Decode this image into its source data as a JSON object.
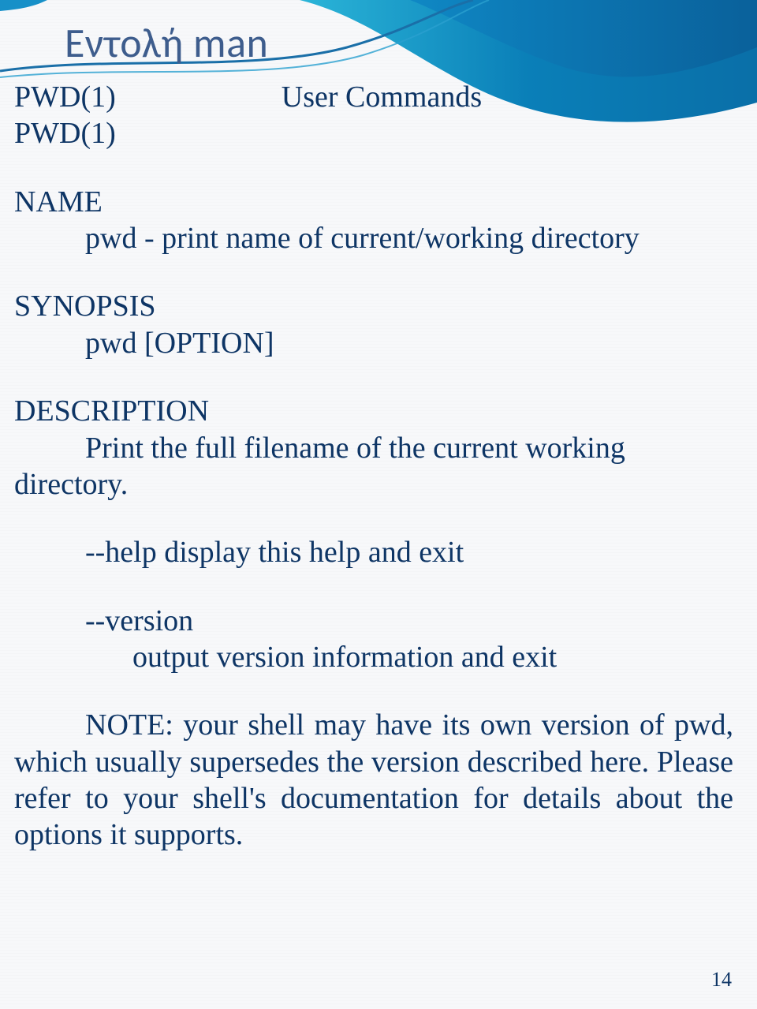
{
  "slide": {
    "title": "Εντολή man",
    "page_number": "14"
  },
  "man": {
    "header_left": "PWD(1)",
    "header_center": "User Commands",
    "header_left_repeat": "PWD(1)",
    "name_heading": "NAME",
    "name_text": "pwd - print name of current/working directory",
    "synopsis_heading": "SYNOPSIS",
    "synopsis_text": "pwd [OPTION]",
    "description_heading": "DESCRIPTION",
    "description_line1": "Print the full filename of the current working",
    "description_line2": "directory.",
    "help_text": "--help display this help and exit",
    "version_flag": "--version",
    "version_text": "output version information and exit",
    "note_text": "NOTE:  your  shell may have its own version of pwd, which usually supersedes the version described here.  Please refer to your shell's documentation  for details about the options it supports."
  }
}
